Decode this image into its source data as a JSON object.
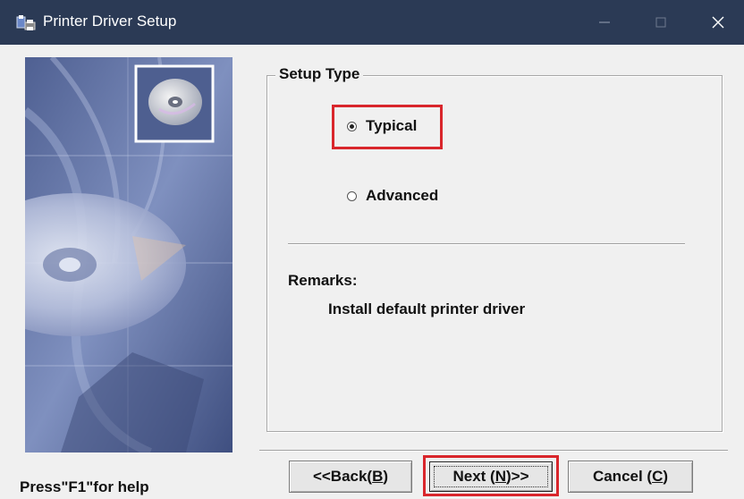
{
  "window": {
    "title": "Printer Driver Setup",
    "controls": [
      "minimize",
      "maximize",
      "close"
    ]
  },
  "banner": {
    "icons": [
      "cd-disc-icon"
    ]
  },
  "setup_type": {
    "legend": "Setup Type",
    "options": [
      {
        "label": "Typical",
        "selected": true
      },
      {
        "label": "Advanced",
        "selected": false
      }
    ],
    "remarks_label": "Remarks:",
    "remarks_text": "Install default printer driver"
  },
  "footer": {
    "help_text": "Press\"F1\"for help",
    "buttons": {
      "back": {
        "pre": "<<Back(",
        "key": "B",
        "post": ")"
      },
      "next": {
        "pre": "Next (",
        "key": "N",
        "post": ")>>"
      },
      "cancel": {
        "pre": "Cancel (",
        "key": "C",
        "post": ")"
      }
    }
  },
  "highlight_color": "#d9262c",
  "titlebar_color": "#2b3a55"
}
